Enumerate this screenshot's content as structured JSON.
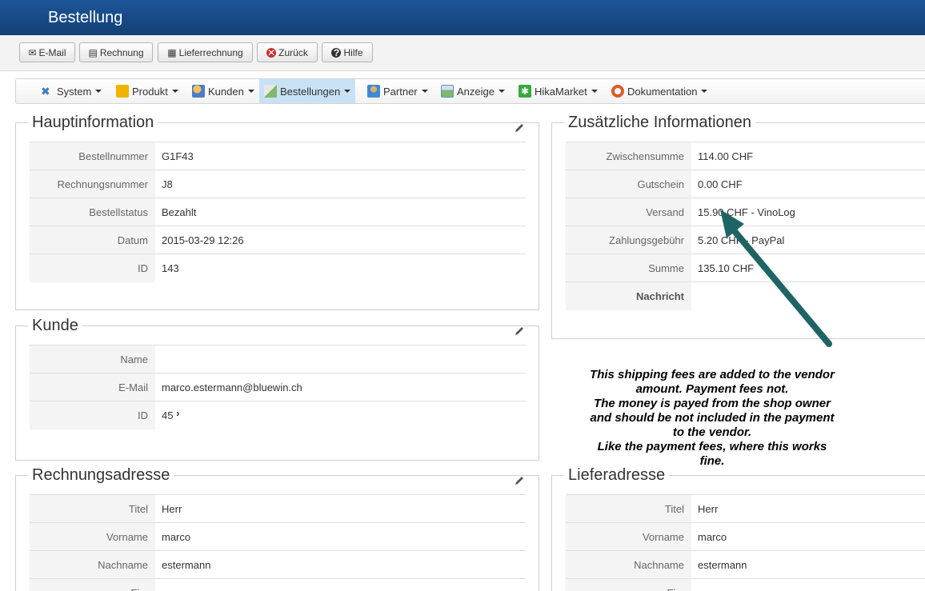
{
  "header": {
    "title": "Bestellung"
  },
  "toolbar": {
    "buttons": [
      {
        "label": "E-Mail",
        "icon": "envelope-icon"
      },
      {
        "label": "Rechnung",
        "icon": "invoice-icon"
      },
      {
        "label": "Lieferrechnung",
        "icon": "delivery-icon"
      },
      {
        "label": "Zurück",
        "icon": "cancel-icon"
      },
      {
        "label": "Hilfe",
        "icon": "help-icon"
      }
    ]
  },
  "menu": {
    "items": [
      {
        "label": "System",
        "icon": "tools-icon"
      },
      {
        "label": "Produkt",
        "icon": "product-icon"
      },
      {
        "label": "Kunden",
        "icon": "users-icon"
      },
      {
        "label": "Bestellungen",
        "icon": "orders-icon",
        "active": true
      },
      {
        "label": "Partner",
        "icon": "partner-icon"
      },
      {
        "label": "Anzeige",
        "icon": "display-icon"
      },
      {
        "label": "HikaMarket",
        "icon": "hikamarket-icon"
      },
      {
        "label": "Dokumentation",
        "icon": "lifebuoy-icon"
      }
    ]
  },
  "main_info": {
    "legend": "Hauptinformation",
    "rows": [
      {
        "key": "Bestellnummer",
        "value": "G1F43"
      },
      {
        "key": "Rechnungsnummer",
        "value": "J8"
      },
      {
        "key": "Bestellstatus",
        "value": "Bezahlt"
      },
      {
        "key": "Datum",
        "value": "2015-03-29 12:26"
      },
      {
        "key": "ID",
        "value": "143"
      }
    ]
  },
  "customer": {
    "legend": "Kunde",
    "rows": [
      {
        "key": "Name",
        "value": ""
      },
      {
        "key": "E-Mail",
        "value": "marco.estermann@bluewin.ch"
      },
      {
        "key": "ID",
        "value": "45"
      }
    ]
  },
  "billing": {
    "legend": "Rechnungsadresse",
    "rows": [
      {
        "key": "Titel",
        "value": "Herr"
      },
      {
        "key": "Vorname",
        "value": "marco"
      },
      {
        "key": "Nachname",
        "value": "estermann"
      },
      {
        "key": "Fi...",
        "value": ""
      }
    ]
  },
  "additional": {
    "legend": "Zusätzliche Informationen",
    "rows": [
      {
        "key": "Zwischensumme",
        "value": "114.00 CHF"
      },
      {
        "key": "Gutschein",
        "value": "0.00 CHF"
      },
      {
        "key": "Versand",
        "value": "15.90 CHF - VinoLog"
      },
      {
        "key": "Zahlungsgebühr",
        "value": "5.20 CHF - PayPal"
      },
      {
        "key": "Summe",
        "value": "135.10 CHF"
      },
      {
        "key": "Nachricht",
        "value": ""
      }
    ]
  },
  "shipping": {
    "legend": "Lieferadresse",
    "rows": [
      {
        "key": "Titel",
        "value": "Herr"
      },
      {
        "key": "Vorname",
        "value": "marco"
      },
      {
        "key": "Nachname",
        "value": "estermann"
      },
      {
        "key": "Fi...",
        "value": ""
      }
    ]
  },
  "annotation": {
    "lines": [
      "This shipping fees are added to the vendor",
      "amount. Payment fees not.",
      "The money is payed from the shop owner",
      "and should be not included in the payment",
      "to the vendor.",
      "Like the payment fees, where this works",
      "fine."
    ],
    "arrow_color": "#1f6465"
  },
  "colors": {
    "header": "#1a4b88",
    "menu_active": "#c8e1f4"
  }
}
